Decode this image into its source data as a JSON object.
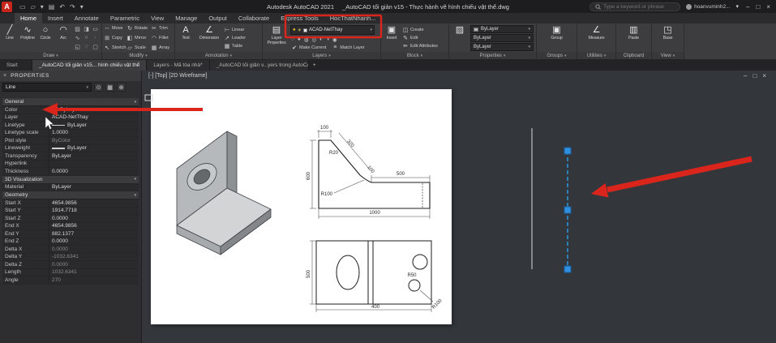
{
  "titlebar": {
    "logo_letter": "A",
    "app_name": "Autodesk AutoCAD 2021",
    "doc_name": "_AutoCAD tối giản v15 - Thực hành vẽ hình chiếu vật thể.dwg",
    "search_placeholder": "Type a keyword or phrase",
    "signin_user": "hoanvuminh2..."
  },
  "ribbon_tabs": {
    "items": [
      "Home",
      "Insert",
      "Annotate",
      "Parametric",
      "View",
      "Manage",
      "Output",
      "Collaborate",
      "Express Tools",
      "HocThatNhanh..."
    ],
    "active": "Home"
  },
  "ribbon": {
    "draw": {
      "label": "Draw",
      "line": "Line",
      "polyline": "Polyline",
      "circle": "Circle",
      "arc": "Arc"
    },
    "modify": {
      "label": "Modify",
      "move": "Move",
      "rotate": "Rotate",
      "trim": "Trim",
      "copy": "Copy",
      "mirror": "Mirror",
      "fillet": "Fillet",
      "stretch": "Stretch",
      "scale": "Scale",
      "array": "Array"
    },
    "annotation": {
      "label": "Annotation",
      "text": "Text",
      "dimension": "Dimension",
      "linear": "Linear",
      "leader": "Leader",
      "table": "Table"
    },
    "layers": {
      "label": "Layers",
      "layer_properties": "Layer Properties",
      "current_layer": "ACAD-NetThay",
      "make_current": "Make Current",
      "match_layer": "Match Layer"
    },
    "block": {
      "label": "Block",
      "insert": "Insert",
      "create": "Create",
      "edit": "Edit",
      "edit_attributes": "Edit Attributes"
    },
    "properties": {
      "label": "Properties",
      "bylayer1": "ByLayer",
      "bylayer2": "ByLayer",
      "bylayer3": "ByLayer"
    },
    "groups": {
      "label": "Groups",
      "group": "Group"
    },
    "utilities": {
      "label": "Utilities",
      "measure": "Measure"
    },
    "clipboard": {
      "label": "Clipboard",
      "paste": "Paste"
    },
    "view": {
      "label": "View",
      "base": "Base"
    }
  },
  "filetabs": {
    "start": "Start",
    "tab1": "_AutoCAD tối giản v15... hình chiếu vật thể",
    "tab2": "Layers - Mã tòa nhà*",
    "tab3": "_AutoCAD tối giản v...yers trong AutoCAD*",
    "add": "+"
  },
  "palette": {
    "title": "PROPERTIES",
    "selector": "Line",
    "general_name": "General",
    "general": [
      {
        "label": "Color",
        "value": "ByLayer"
      },
      {
        "label": "Layer",
        "value": "ACAD-NetThay"
      },
      {
        "label": "Linetype",
        "value": "ByLayer"
      },
      {
        "label": "Linetype scale",
        "value": "1.0000"
      },
      {
        "label": "Plot style",
        "value": "ByColor"
      },
      {
        "label": "Lineweight",
        "value": "ByLayer"
      },
      {
        "label": "Transparency",
        "value": "ByLayer"
      },
      {
        "label": "Hyperlink",
        "value": ""
      },
      {
        "label": "Thickness",
        "value": "0.0000"
      }
    ],
    "viz_name": "3D Visualization",
    "viz": [
      {
        "label": "Material",
        "value": "ByLayer"
      }
    ],
    "geometry_name": "Geometry",
    "geometry": [
      {
        "label": "Start X",
        "value": "4654.9856"
      },
      {
        "label": "Start Y",
        "value": "1914.7718"
      },
      {
        "label": "Start Z",
        "value": "0.0000"
      },
      {
        "label": "End X",
        "value": "4654.9856"
      },
      {
        "label": "End Y",
        "value": "882.1377"
      },
      {
        "label": "End Z",
        "value": "0.0000"
      },
      {
        "label": "Delta X",
        "value": "0.0000"
      },
      {
        "label": "Delta Y",
        "value": "-1032.6341"
      },
      {
        "label": "Delta Z",
        "value": "0.0000"
      },
      {
        "label": "Length",
        "value": "1032.6341"
      },
      {
        "label": "Angle",
        "value": "270"
      }
    ]
  },
  "viewport": {
    "minus": "[-]",
    "view": "[Top]",
    "style": "[2D Wireframe]"
  },
  "drawing_dims": {
    "d100_top": "100",
    "d320": "320",
    "r20": "R20",
    "d600": "600",
    "r100_front": "R100",
    "d100_mid": "100",
    "d500_arm": "500",
    "d1000": "1000",
    "d500_plan": "500",
    "d400": "400",
    "r50": "R50",
    "r100_plan": "R100"
  },
  "annotation": {
    "color": "#da251c"
  },
  "selection": {
    "line_color": "#27a3e8",
    "grip_color": "#2f8fe0"
  },
  "icons": {
    "caret_down": "▾",
    "line": "╱",
    "polyline": "∿",
    "circle": "○",
    "arc": "◠",
    "hatch": "▨",
    "gradient": "◨",
    "boundary": "▭",
    "spline": "∿",
    "ellipse": "○",
    "point": "·",
    "region": "◱",
    "revcloud": "◌",
    "wipeout": "▢",
    "move": "↔",
    "rotate": "↻",
    "trim": "✂",
    "copy": "⊞",
    "mirror": "◧",
    "fillet": "◠",
    "stretch": "↖",
    "scale": "▱",
    "array": "▦",
    "text": "A",
    "dimension": "∠",
    "linear": "⊢",
    "leader": "↗",
    "table": "▦",
    "layer_props": "▤",
    "bulb": "●",
    "sun": "☀",
    "make_current": "✔",
    "match_layer": "≡",
    "layer_off": "◌",
    "layer_on": "●",
    "layer_freeze": "◍",
    "layer_thaw": "◎",
    "layer_lock": "◐",
    "layer_unlock": "◑",
    "layer_isolate": "◉",
    "insert": "▣",
    "create": "◫",
    "edit": "✎",
    "edit_attr": "✏",
    "match_props": "▨",
    "group": "▣",
    "measure": "∠",
    "paste": "▥",
    "base": "◳",
    "win_min": "–",
    "win_max": "□",
    "win_close": "×",
    "plus": "+",
    "new": "▭",
    "open": "▱",
    "save": "▾",
    "plot": "▤",
    "undo": "↶",
    "redo": "↷",
    "select": "⊙",
    "grid": "▦",
    "pickadd": "⊕"
  }
}
